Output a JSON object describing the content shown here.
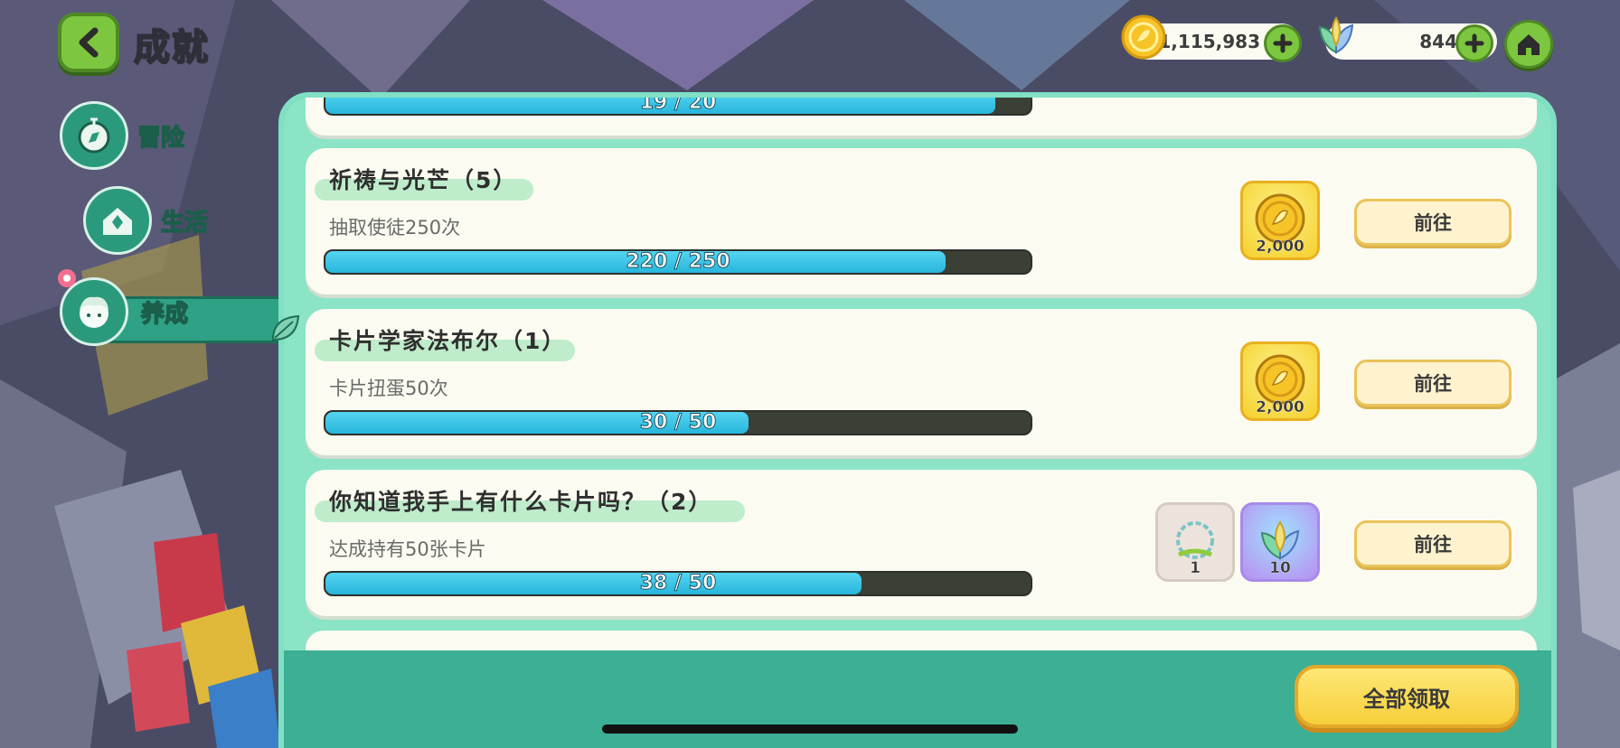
{
  "header": {
    "title": "成就",
    "gold_amount": "1,115,983",
    "leaf_amount": "844"
  },
  "nav": {
    "items": [
      {
        "label": "冒险"
      },
      {
        "label": "生活"
      },
      {
        "label": "养成"
      }
    ],
    "active": "养成"
  },
  "achievements": [
    {
      "title": "",
      "desc": "",
      "progress_text": "19 / 20",
      "current": 19,
      "total": 20
    },
    {
      "title": "祈祷与光芒（5）",
      "desc": "抽取使徒250次",
      "progress_text": "220 / 250",
      "current": 220,
      "total": 250,
      "rewards": [
        {
          "icon": "gold-coin-icon",
          "qty": "2,000"
        }
      ],
      "button": "前往"
    },
    {
      "title": "卡片学家法布尔（1）",
      "desc": "卡片扭蛋50次",
      "progress_text": "30 / 50",
      "current": 30,
      "total": 50,
      "rewards": [
        {
          "icon": "gold-coin-icon",
          "qty": "2,000"
        }
      ],
      "button": "前往"
    },
    {
      "title": "你知道我手上有什么卡片吗？（2）",
      "desc": "达成持有50张卡片",
      "progress_text": "38 / 50",
      "current": 38,
      "total": 50,
      "rewards": [
        {
          "icon": "frame-icon",
          "qty": "1"
        },
        {
          "icon": "rainbow-leaf-gem-icon",
          "qty": "10"
        }
      ],
      "button": "前往"
    }
  ],
  "footer": {
    "claim_all": "全部领取"
  },
  "colors": {
    "panel": "#3caf95",
    "list_bg": "#8be4c6",
    "bar_fill": "#27b6dc",
    "button_gold": "#f6cf3a",
    "nav_green": "#2b9a7c"
  }
}
